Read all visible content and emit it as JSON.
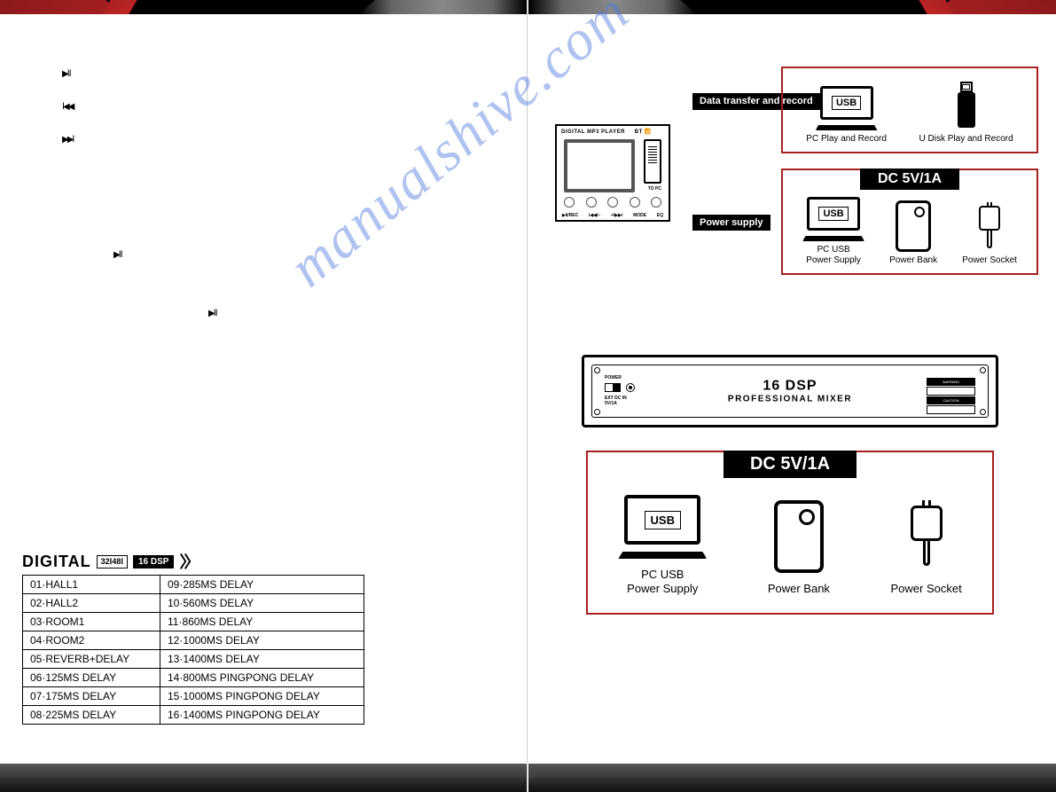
{
  "watermark": "manualshive.com",
  "left_page": {
    "icons": [
      "▶Ⅱ",
      "Ⅰ◀◀",
      "▶▶Ⅰ"
    ],
    "icons_lower": [
      "▶Ⅱ",
      "▶Ⅱ"
    ],
    "section_header": {
      "word": "DIGITAL",
      "pill1": "32Ⅰ48Ⅰ",
      "pill2": "16 DSP",
      "chev": "〉〉"
    },
    "dsp_table": [
      [
        "01·HALL1",
        "09·285MS DELAY"
      ],
      [
        "02·HALL2",
        "10·560MS DELAY"
      ],
      [
        "03·ROOM1",
        "11·860MS DELAY"
      ],
      [
        "04·ROOM2",
        "12·1000MS DELAY"
      ],
      [
        "05·REVERB+DELAY",
        "13·1400MS DELAY"
      ],
      [
        "06·125MS DELAY",
        "14·800MS PINGPONG DELAY"
      ],
      [
        "07·175MS DELAY",
        "15·1000MS PINGPONG DELAY"
      ],
      [
        "08·225MS DELAY",
        "16·1400MS PINGPONG DELAY"
      ]
    ]
  },
  "right_page": {
    "mp3_player": {
      "title": "DIGITAL MP3 PLAYER",
      "bt": "BT 📶",
      "topc": "TO PC",
      "btn_labels": [
        "▶Ⅱ/REC",
        "Ⅰ◀◀/−",
        "+/▶▶Ⅰ",
        "MODE",
        "EQ"
      ]
    },
    "labels": {
      "data_transfer": "Data transfer\nand record",
      "power_supply": "Power supply"
    },
    "box_data": {
      "usb": "USB",
      "pc_play": "PC Play and Record",
      "udisk_play": "U Disk Play and Record"
    },
    "box_power": {
      "header": "DC 5V/1A",
      "usb": "USB",
      "pc_usb": "PC USB\nPower Supply",
      "powerbank": "Power Bank",
      "socket": "Power Socket"
    },
    "mixer": {
      "dsp": "16 DSP",
      "sub": "PROFESSIONAL MIXER",
      "power": "POWER",
      "voltage": "EXT DC IN\n5V/1A",
      "warning": "WARNING",
      "caution": "CAUTION"
    },
    "box_bottom": {
      "header": "DC 5V/1A",
      "usb": "USB",
      "pc_usb": "PC USB\nPower Supply",
      "powerbank": "Power Bank",
      "socket": "Power Socket"
    }
  }
}
